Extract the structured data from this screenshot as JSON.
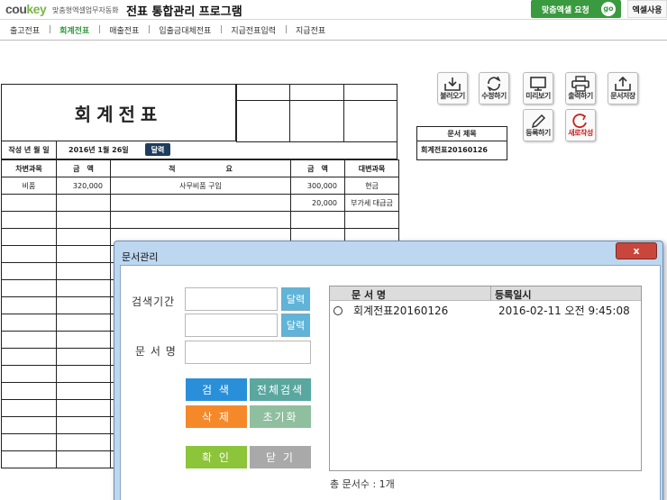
{
  "header": {
    "logo_main": "cou",
    "logo_accent": "key",
    "logo_subtitle": "맞춤형엑셀업무자동화",
    "app_title": "전표 통합관리 프로그램",
    "request_button": "맞춤엑셀 요청",
    "go_badge": "go",
    "excel_use": "엑셀사용"
  },
  "tabs": [
    {
      "label": "출고전표",
      "active": false
    },
    {
      "label": "회계전표",
      "active": true
    },
    {
      "label": "매출전표",
      "active": false
    },
    {
      "label": "입출금대체전표",
      "active": false
    },
    {
      "label": "지급전표입력",
      "active": false
    },
    {
      "label": "지급전표",
      "active": false
    }
  ],
  "voucher": {
    "title": "회계전표",
    "date_label": "작성 년 월 일",
    "date_value": "2016년 1월 26일",
    "calendar_button": "달력",
    "columns": [
      "차변과목",
      "금　액",
      "적　　　　　　　요",
      "금　액",
      "대변과목"
    ],
    "rows": [
      [
        "비품",
        "320,000",
        "사무비품 구입",
        "300,000",
        "현금"
      ],
      [
        "",
        "",
        "",
        "20,000",
        "부가세 대급금"
      ],
      [
        "",
        "",
        "",
        "",
        ""
      ],
      [
        "",
        "",
        "",
        "",
        ""
      ],
      [
        "",
        "",
        "",
        "",
        ""
      ]
    ]
  },
  "toolbar": {
    "load": "불러오기",
    "edit": "수정하기",
    "preview": "미리보기",
    "print": "출력하기",
    "save_doc": "문서저장",
    "register": "등록하기",
    "new": "새로작성"
  },
  "doc_title_box": {
    "header": "문서 제목",
    "value": "회계전표20160126"
  },
  "dialog": {
    "title": "문서관리",
    "close": "x",
    "search_period_label": "검색기간",
    "calendar_btn_1": "달력",
    "calendar_btn_2": "달력",
    "doc_name_label": "문 서 명",
    "search_btn": "검 색",
    "search_all_btn": "전체검색",
    "delete_btn": "삭 제",
    "reset_btn": "초기화",
    "ok_btn": "확 인",
    "close_btn": "닫 기",
    "list_headers": {
      "name": "문 서 명",
      "date": "등록일시"
    },
    "list_rows": [
      {
        "name": "회계전표20160126",
        "date": "2016-02-11 오전 9:45:08"
      }
    ],
    "total": "총 문서수 : 1개"
  },
  "colors": {
    "brand_green": "#3a9a3f",
    "active_tab": "#2a9a3a",
    "calendar_btn": "#1e3d5c",
    "dialog_frame": "#bcd7ef",
    "btn_blue": "#2a8fd9",
    "btn_teal": "#5aa7a0",
    "btn_orange": "#f5892a",
    "btn_sage": "#8fbf9f",
    "btn_green": "#8cc43a",
    "btn_gray": "#a9a9a9"
  }
}
